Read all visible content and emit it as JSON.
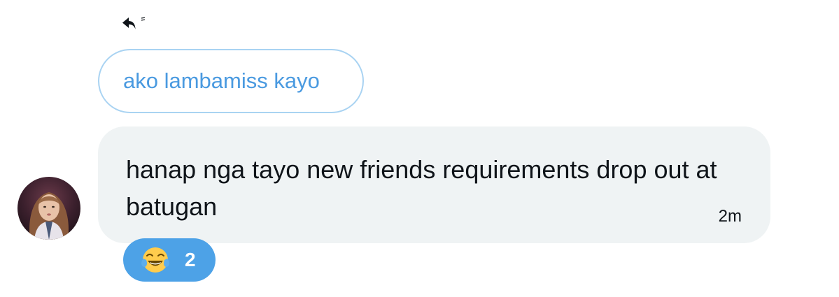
{
  "reply": {
    "icon": "reply-arrow-icon",
    "quoted_text": "ako lambamiss kayo"
  },
  "message": {
    "avatar": "user-avatar",
    "text": "hanap nga tayo new friends requirements drop out at batugan",
    "timestamp": "2m"
  },
  "reaction": {
    "emoji": "face-with-tears-of-joy-icon",
    "count": "2"
  },
  "colors": {
    "accent_blue": "#4da2e7",
    "quote_text": "#4a9ae0",
    "quote_border": "#a9d3f2",
    "bubble_bg": "#eff3f4",
    "text": "#0f1419"
  }
}
